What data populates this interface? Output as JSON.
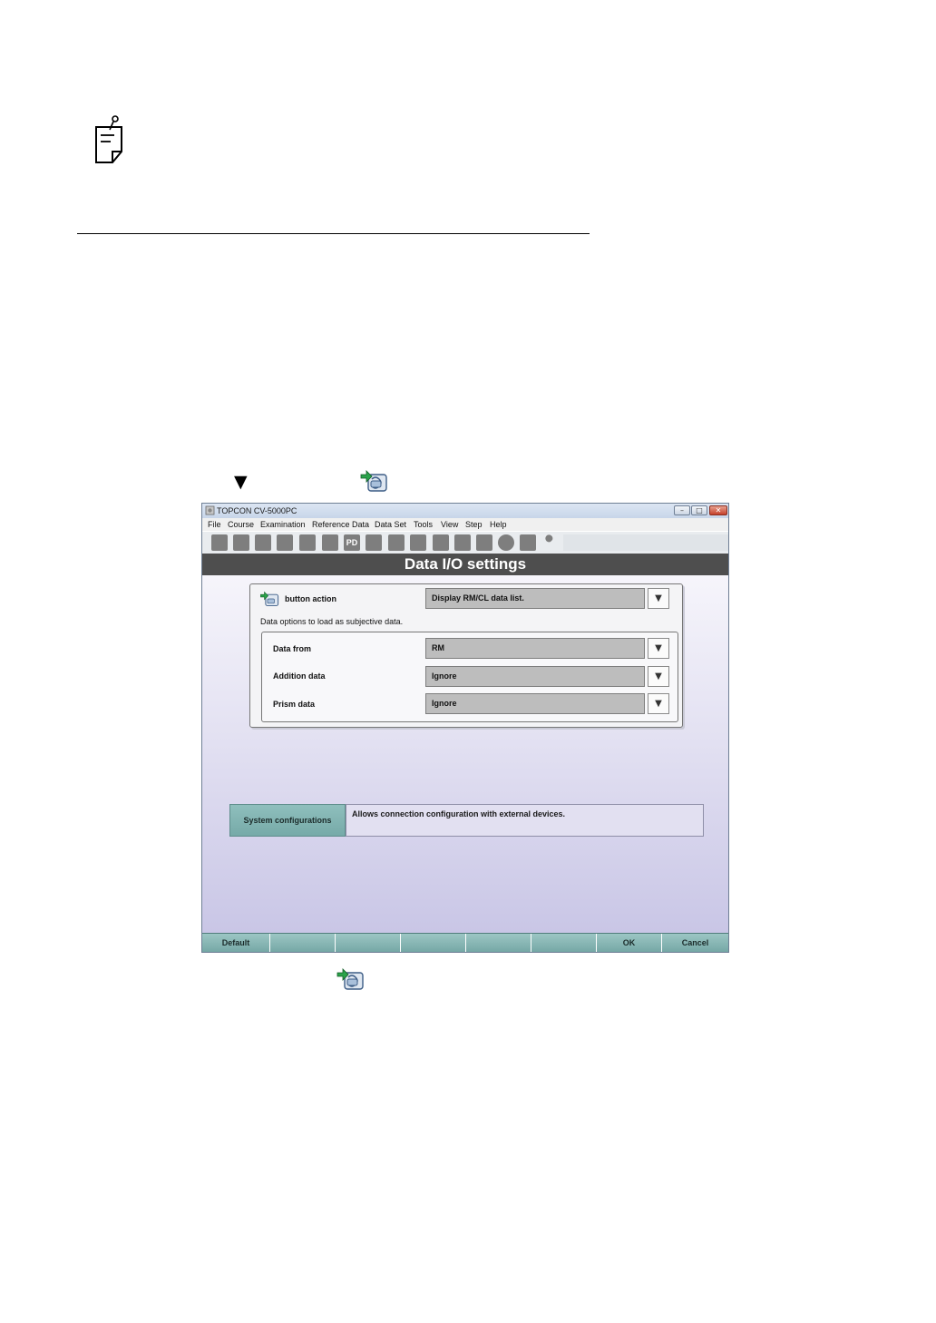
{
  "window": {
    "title": "TOPCON CV-5000PC",
    "minimize": "–",
    "maximize": "□",
    "close": "✕"
  },
  "menu": [
    "File",
    "Course",
    "Examination",
    "Reference Data",
    "Data Set",
    "Tools",
    "View",
    "Step",
    "Help"
  ],
  "toolbar": {
    "pd_label": "PD"
  },
  "header": {
    "title": "Data I/O settings"
  },
  "settings": {
    "button_action_label": "button action",
    "button_action_value": "Display RM/CL data list.",
    "options_caption": "Data options to load as subjective data.",
    "data_from_label": "Data from",
    "data_from_value": "RM",
    "addition_label": "Addition data",
    "addition_value": "Ignore",
    "prism_label": "Prism data",
    "prism_value": "Ignore",
    "dropdown_glyph": "▼"
  },
  "system": {
    "button_label": "System configurations",
    "description": "Allows connection configuration with external devices."
  },
  "bottom": {
    "default": "Default",
    "ok": "OK",
    "cancel": "Cancel"
  },
  "page": {
    "arrow": "▼"
  },
  "colors": {
    "header_bg": "#4e4e4e",
    "accent_teal": "#8fbfbd",
    "content_lavender": "#c9c6e6"
  }
}
